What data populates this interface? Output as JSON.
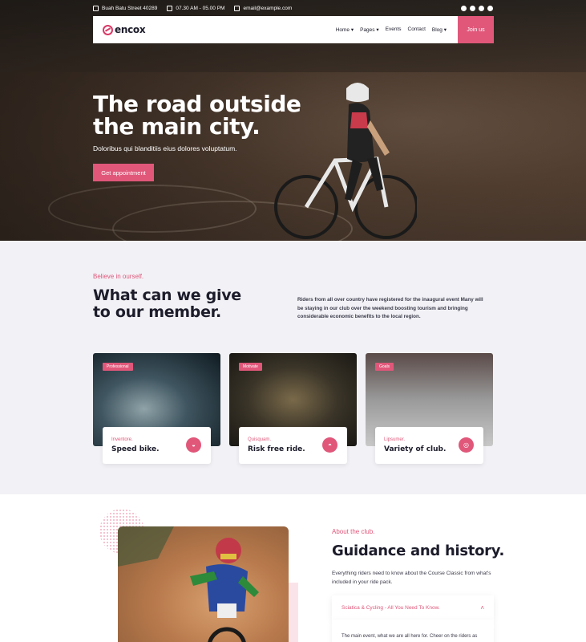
{
  "topbar": {
    "address": "Buah Batu Street 40289",
    "hours": "07.30 AM - 05.00 PM",
    "email": "email@example.com",
    "social_icons": [
      "instagram-icon",
      "pinterest-icon",
      "twitter-icon",
      "facebook-icon"
    ]
  },
  "nav": {
    "logo": "encox",
    "items": [
      {
        "label": "Home",
        "dropdown": true
      },
      {
        "label": "Pages",
        "dropdown": true
      },
      {
        "label": "Events",
        "dropdown": false
      },
      {
        "label": "Contact",
        "dropdown": false
      },
      {
        "label": "Blog",
        "dropdown": true
      }
    ],
    "cta": "Join us"
  },
  "hero": {
    "title": "The road outside the main city.",
    "subtitle": "Doloribus qui blanditiis eius dolores voluptatum.",
    "button": "Get appointment"
  },
  "features": {
    "eyebrow": "Believe in ourself.",
    "title": "What can we give to our member.",
    "description": "Riders from all over country have registered for the inaugural event Many will be staying in our club over the weekend boosting tourism and bringing considerable economic benefits to the local region.",
    "cards": [
      {
        "tag": "Professional",
        "small": "Inventore.",
        "title": "Speed bike."
      },
      {
        "tag": "Motivate",
        "small": "Quisquam.",
        "title": "Risk free ride."
      },
      {
        "tag": "Goals",
        "small": "Lipsumer.",
        "title": "Variety of club."
      }
    ]
  },
  "about": {
    "eyebrow": "About the club.",
    "title": "Guidance and history.",
    "description": "Everything riders need to know about the Course Classic from what's included in your ride pack.",
    "accordion_title": "Sciatica & Cycling - All You Need To Know.",
    "accordion_body": "The main event, what we are all here for. Cheer on the riders as"
  },
  "colors": {
    "accent": "#e0577a",
    "dark": "#1c1c2b"
  }
}
